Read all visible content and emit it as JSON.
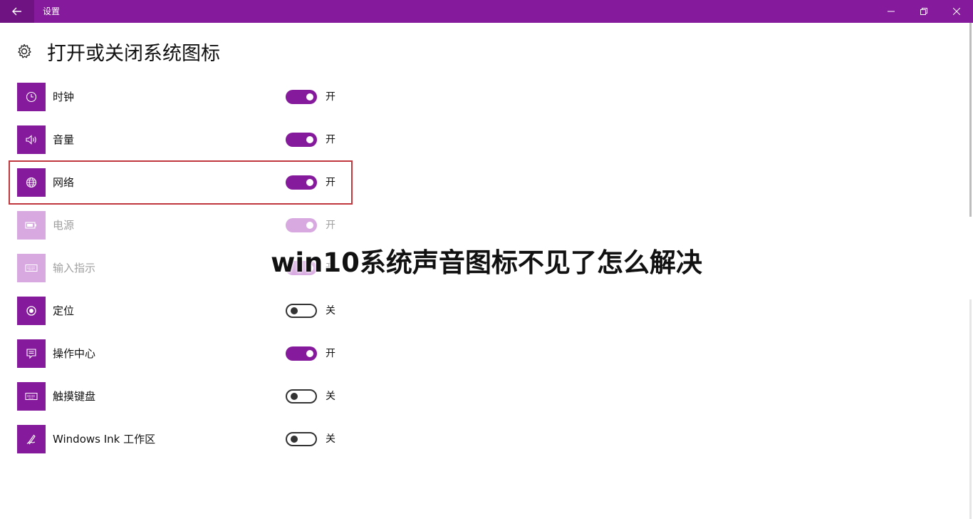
{
  "window": {
    "title": "设置",
    "buttons": [
      "minimize",
      "maximize",
      "close"
    ]
  },
  "header": {
    "title": "打开或关闭系统图标",
    "icon": "gear-icon"
  },
  "rows": [
    {
      "label": "时钟",
      "state": "开",
      "on": true,
      "enabled": true,
      "icon": "clock-icon"
    },
    {
      "label": "音量",
      "state": "开",
      "on": true,
      "enabled": true,
      "icon": "volume-icon"
    },
    {
      "label": "网络",
      "state": "开",
      "on": true,
      "enabled": true,
      "icon": "globe-icon",
      "highlighted": true
    },
    {
      "label": "电源",
      "state": "开",
      "on": true,
      "enabled": false,
      "icon": "battery-icon"
    },
    {
      "label": "输入指示",
      "state": "开",
      "on": true,
      "enabled": false,
      "icon": "keyboard-icon"
    },
    {
      "label": "定位",
      "state": "关",
      "on": false,
      "enabled": true,
      "icon": "location-icon"
    },
    {
      "label": "操作中心",
      "state": "开",
      "on": true,
      "enabled": true,
      "icon": "action-center-icon"
    },
    {
      "label": "触摸键盘",
      "state": "关",
      "on": false,
      "enabled": true,
      "icon": "touch-keyboard-icon"
    },
    {
      "label": "Windows Ink 工作区",
      "state": "关",
      "on": false,
      "enabled": true,
      "icon": "pen-icon"
    }
  ],
  "overlay": {
    "caption": "win10系统声音图标不见了怎么解决"
  },
  "colors": {
    "accent": "#861a9c",
    "accent_disabled": "#d7a9e0",
    "highlight_border": "#c0373d"
  }
}
